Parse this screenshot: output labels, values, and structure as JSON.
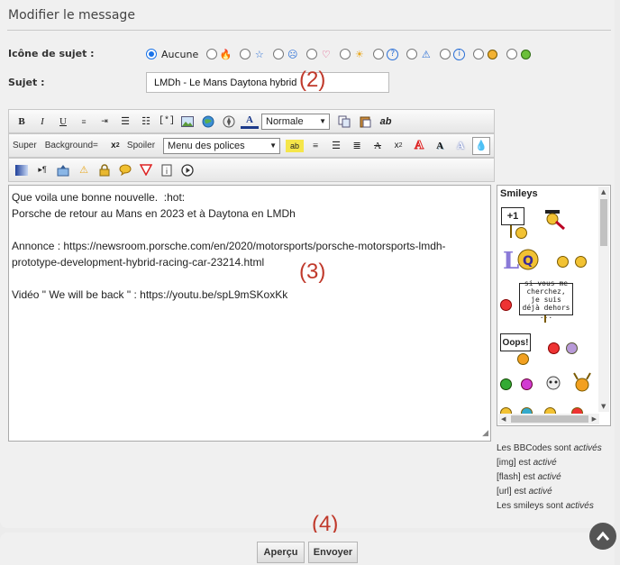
{
  "panel": {
    "title": "Modifier le message"
  },
  "topic_icon": {
    "label": "Icône de sujet :",
    "selected_label": "Aucune",
    "options": [
      "fire-icon",
      "star-icon",
      "sad-face-icon",
      "heart-icon",
      "sun-icon",
      "question-icon",
      "warning-icon",
      "info-icon",
      "angry-face-icon",
      "grin-face-icon"
    ]
  },
  "subject": {
    "label": "Sujet :",
    "value": "LMDh - Le Mans Daytona hybrid"
  },
  "annotations": {
    "a2": "(2)",
    "a3": "(3)",
    "a4": "(4)"
  },
  "toolbar": {
    "font_size_value": "Normale",
    "super_label": "Super",
    "background_label": "Background=",
    "spoiler_label": "Spoiler",
    "font_menu_value": "Menu des polices"
  },
  "message": {
    "lines": [
      "Que voila une bonne nouvelle.  :hot:",
      "Porsche de retour au Mans en 2023 et à Daytona en LMDh",
      "",
      "Annonce : https://newsroom.porsche.com/en/2020/motorsports/porsche-motorsports-lmdh-",
      "prototype-development-hybrid-racing-car-23214.html",
      "",
      "Vidéo \" We will be back \" : https://youtu.be/spL9mSKoxKk"
    ]
  },
  "smileys": {
    "title": "Smileys",
    "plus_one": "+1",
    "oops": "Oops!",
    "sign_text": "si vous me cherchez, je suis déjà dehors ..."
  },
  "bbcode_info": {
    "bbcodes_prefix": "Les BBCodes sont",
    "bbcodes_state": "activés",
    "img_prefix": "[img] est",
    "img_state": "activé",
    "flash_prefix": "[flash] est",
    "flash_state": "activé",
    "url_prefix": "[url] est",
    "url_state": "activé",
    "smileys_prefix": "Les smileys sont",
    "smileys_state": "activés"
  },
  "buttons": {
    "preview": "Aperçu",
    "send": "Envoyer"
  },
  "colors": {
    "accent": "#1a73e8",
    "annotation": "#c0392b"
  }
}
